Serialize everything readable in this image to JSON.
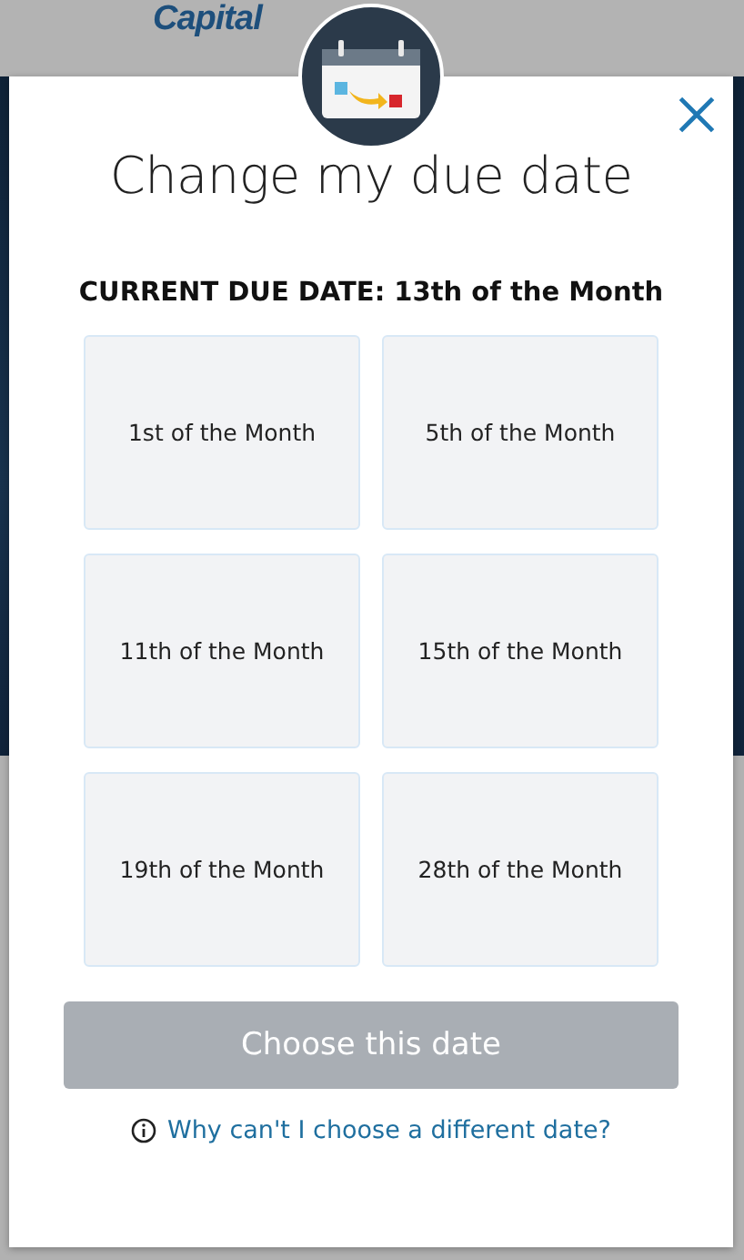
{
  "background": {
    "logo": "Capital"
  },
  "dialog": {
    "title": "Change my due date",
    "current_due_date": "CURRENT DUE DATE: 13th of the Month",
    "options": [
      {
        "label": "1st of the Month",
        "selected": false
      },
      {
        "label": "5th of the Month",
        "selected": false
      },
      {
        "label": "11th of the Month",
        "selected": false
      },
      {
        "label": "15th of the Month",
        "selected": false
      },
      {
        "label": "19th of the Month",
        "selected": false
      },
      {
        "label": "28th of the Month",
        "selected": false
      }
    ],
    "submit": {
      "label": "Choose this date",
      "disabled": true
    },
    "help_link": "Why can't I choose a different date?"
  }
}
